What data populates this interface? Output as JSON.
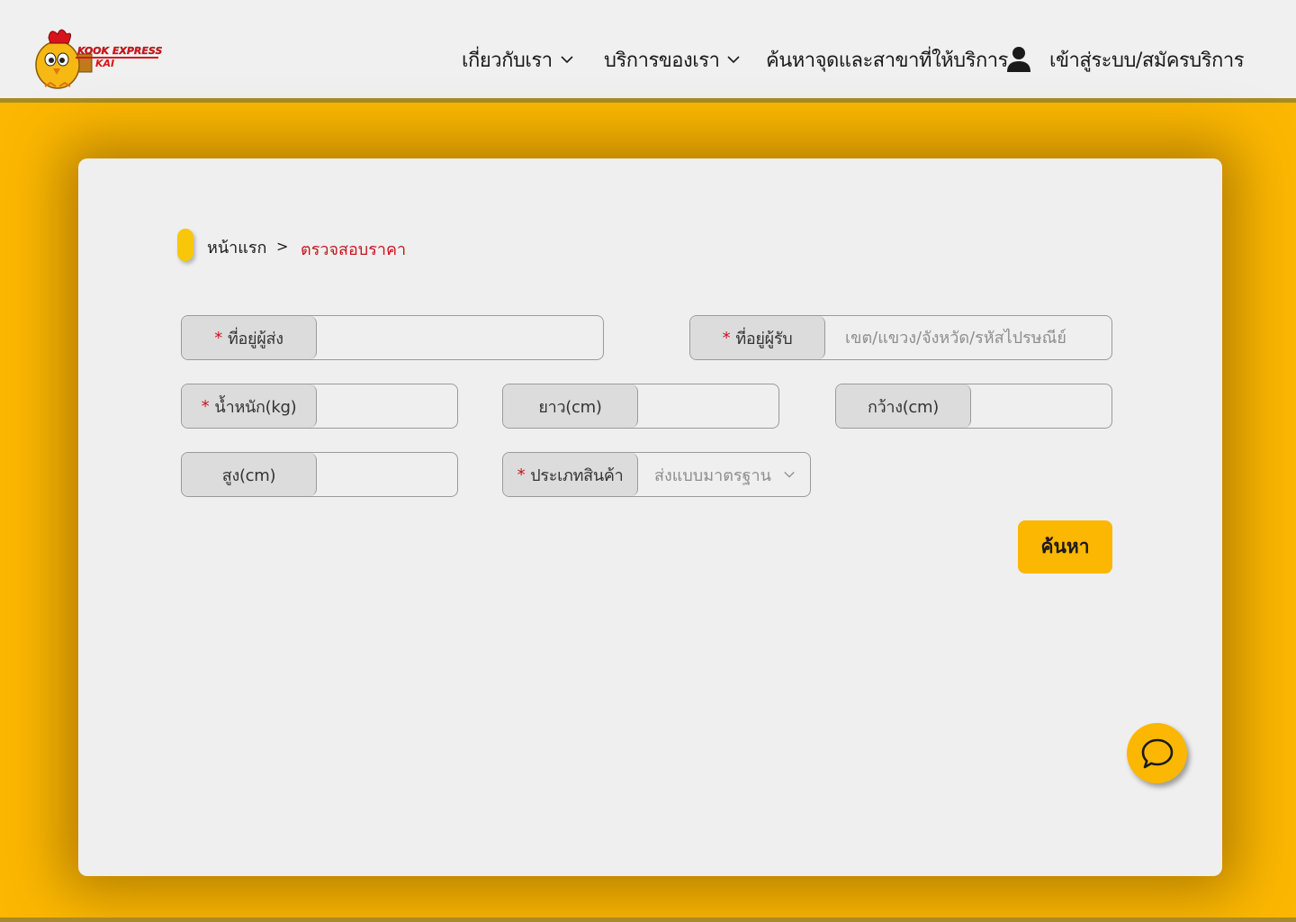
{
  "header": {
    "logo": {
      "text_line1": "KOOK EXPRESS",
      "text_line2": "KAI",
      "icon": "chicken-mascot-logo"
    },
    "nav": {
      "about": "เกี่ยวกับเรา",
      "services": "บริการของเรา",
      "find_branch": "ค้นหาจุดและสาขาที่ให้บริการ",
      "login": "เข้าสู่ระบบ/สมัครบริการ"
    }
  },
  "breadcrumb": {
    "home": "หน้าแรก",
    "separator": ">",
    "current": "ตรวจสอบราคา"
  },
  "form": {
    "required_mark": "*",
    "sender_address": {
      "label": "ที่อยู่ผู้ส่ง",
      "value": "",
      "placeholder": ""
    },
    "receiver_address": {
      "label": "ที่อยู่ผู้รับ",
      "value": "",
      "placeholder": "เขต/แขวง/จังหวัด/รหัสไปรษณีย์"
    },
    "weight": {
      "label": "น้ำหนัก(kg)",
      "value": ""
    },
    "length": {
      "label": "ยาว(cm)",
      "value": ""
    },
    "width": {
      "label": "กว้าง(cm)",
      "value": ""
    },
    "height": {
      "label": "สูง(cm)",
      "value": ""
    },
    "product_type": {
      "label": "ประเภทสินค้า",
      "selected": "ส่งแบบมาตรฐาน"
    },
    "search_button": "ค้นหา"
  },
  "colors": {
    "brand_yellow": "#fbb701",
    "accent_red": "#c8151b",
    "header_bg": "#f0f0f0",
    "card_bg": "#efefef"
  },
  "icons": {
    "dropdown": "chevron-down-icon",
    "user": "user-icon",
    "chat": "chat-bubble-icon"
  }
}
